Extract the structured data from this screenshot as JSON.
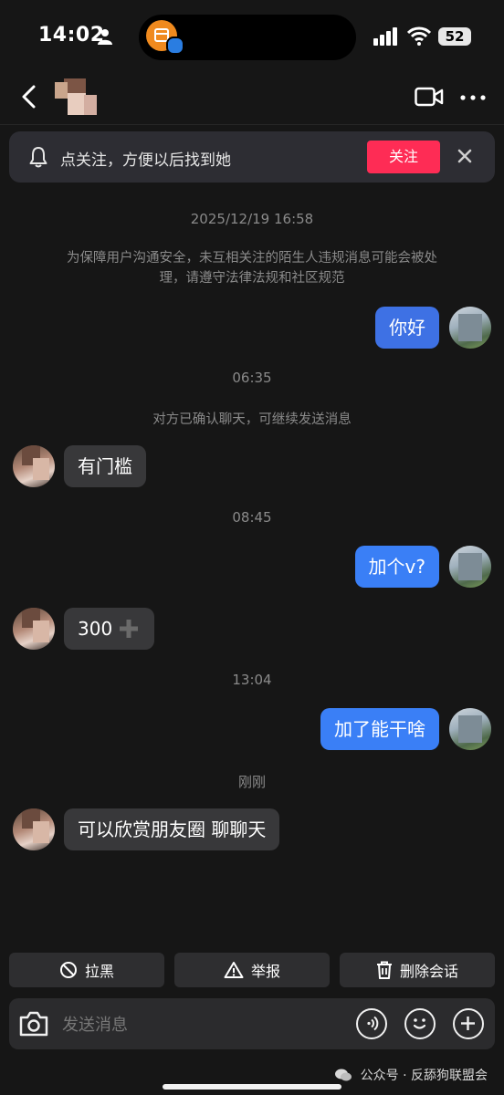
{
  "status_bar": {
    "time": "14:02",
    "battery": "52"
  },
  "banner": {
    "text": "点关注，方便以后找到她",
    "follow_label": "关注"
  },
  "chat": {
    "date_stamp": "2025/12/19 16:58",
    "safety_notice_line1": "为保障用户沟通安全，未互相关注的陌生人违规消息可能会被处",
    "safety_notice_line2": "理，请遵守法律法规和社区规范",
    "messages": [
      {
        "from": "me",
        "text": "你好"
      },
      {
        "type": "time",
        "text": "06:35"
      },
      {
        "type": "system",
        "text": "对方已确认聊天，可继续发送消息"
      },
      {
        "from": "other",
        "text": "有门槛"
      },
      {
        "type": "time",
        "text": "08:45"
      },
      {
        "from": "me",
        "text": "加个v?"
      },
      {
        "from": "other",
        "text": "300"
      },
      {
        "type": "time",
        "text": "13:04"
      },
      {
        "from": "me",
        "text": "加了能干啥"
      },
      {
        "type": "time",
        "text": "刚刚"
      },
      {
        "from": "other",
        "text": "可以欣赏朋友圈 聊聊天"
      }
    ]
  },
  "actions": {
    "block": "拉黑",
    "report": "举报",
    "delete": "删除会话"
  },
  "input": {
    "placeholder": "发送消息"
  },
  "watermark": "公众号 · 反舔狗联盟会",
  "colors": {
    "accent_red": "#fe2c55",
    "bubble_blue": "#3e71e4",
    "background": "#161616"
  }
}
